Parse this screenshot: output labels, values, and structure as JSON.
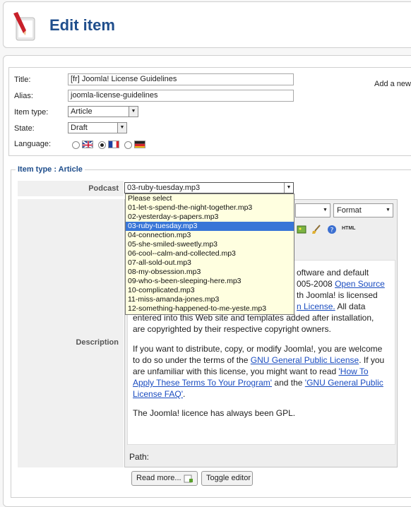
{
  "header": {
    "title": "Edit item"
  },
  "form": {
    "title_label": "Title:",
    "title_value": "[fr] Joomla! License Guidelines",
    "alias_label": "Alias:",
    "alias_value": "joomla-license-guidelines",
    "item_type_label": "Item type:",
    "item_type_value": "Article",
    "state_label": "State:",
    "state_value": "Draft",
    "language_label": "Language:",
    "add_new": "Add a new"
  },
  "item_type_section": {
    "legend": "Item type : Article",
    "podcast_label": "Podcast",
    "podcast_value": "03-ruby-tuesday.mp3",
    "description_label": "Description"
  },
  "podcast_options": [
    "Please select",
    "01-let-s-spend-the-night-together.mp3",
    "02-yesterday-s-papers.mp3",
    "03-ruby-tuesday.mp3",
    "04-connection.mp3",
    "05-she-smiled-sweetly.mp3",
    "06-cool--calm-and-collected.mp3",
    "07-all-sold-out.mp3",
    "08-my-obsession.mp3",
    "09-who-s-been-sleeping-here.mp3",
    "10-complicated.mp3",
    "11-miss-amanda-jones.mp3",
    "12-something-happened-to-me-yeste.mp3"
  ],
  "editor": {
    "format_label": "Format",
    "html_label": "HTML",
    "p1_frag1": "oftware and default",
    "p1_frag2": "005-2008",
    "p1_link1": "Open Source",
    "p1_frag3": "th Joomla! is licensed",
    "p1_link2": "n License.",
    "p1_frag4": "All data",
    "p1_line5": "entered into this Web site and templates added after installation,",
    "p1_line6": "are copyrighted by their respective copyright owners.",
    "p2_text1": "If you want to distribute, copy, or modify Joomla!, you are",
    "p2_text2": "welcome to do so under the terms of the",
    "p2_link1": "GNU General Public License",
    "p2_text3": ". If you are unfamiliar with this license, you might want to read",
    "p2_link2": "'How To Apply These Terms To Your Program'",
    "p2_text4": "and the",
    "p2_link3": "'GNU General Public License FAQ'",
    "p2_text5": ".",
    "p3": "The Joomla! licence has always been GPL.",
    "path_label": "Path:"
  },
  "buttons": {
    "read_more": "Read more...",
    "toggle_editor": "Toggle editor"
  }
}
